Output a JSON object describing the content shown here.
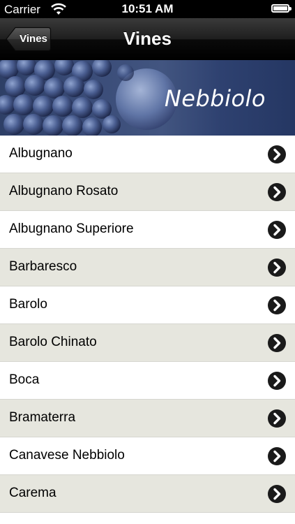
{
  "status_bar": {
    "carrier": "Carrier",
    "time": "10:51 AM"
  },
  "nav": {
    "back_label": "Vines",
    "title": "Vines"
  },
  "banner": {
    "text": "Nebbiolo"
  },
  "list": {
    "items": [
      {
        "label": "Albugnano"
      },
      {
        "label": "Albugnano Rosato"
      },
      {
        "label": "Albugnano Superiore"
      },
      {
        "label": "Barbaresco"
      },
      {
        "label": "Barolo"
      },
      {
        "label": "Barolo Chinato"
      },
      {
        "label": "Boca"
      },
      {
        "label": "Bramaterra"
      },
      {
        "label": "Canavese Nebbiolo"
      },
      {
        "label": "Carema"
      }
    ]
  },
  "colors": {
    "alt_row": "#e6e6de",
    "nav_bar": "#1e1e1e",
    "banner": "#3a4c78"
  }
}
